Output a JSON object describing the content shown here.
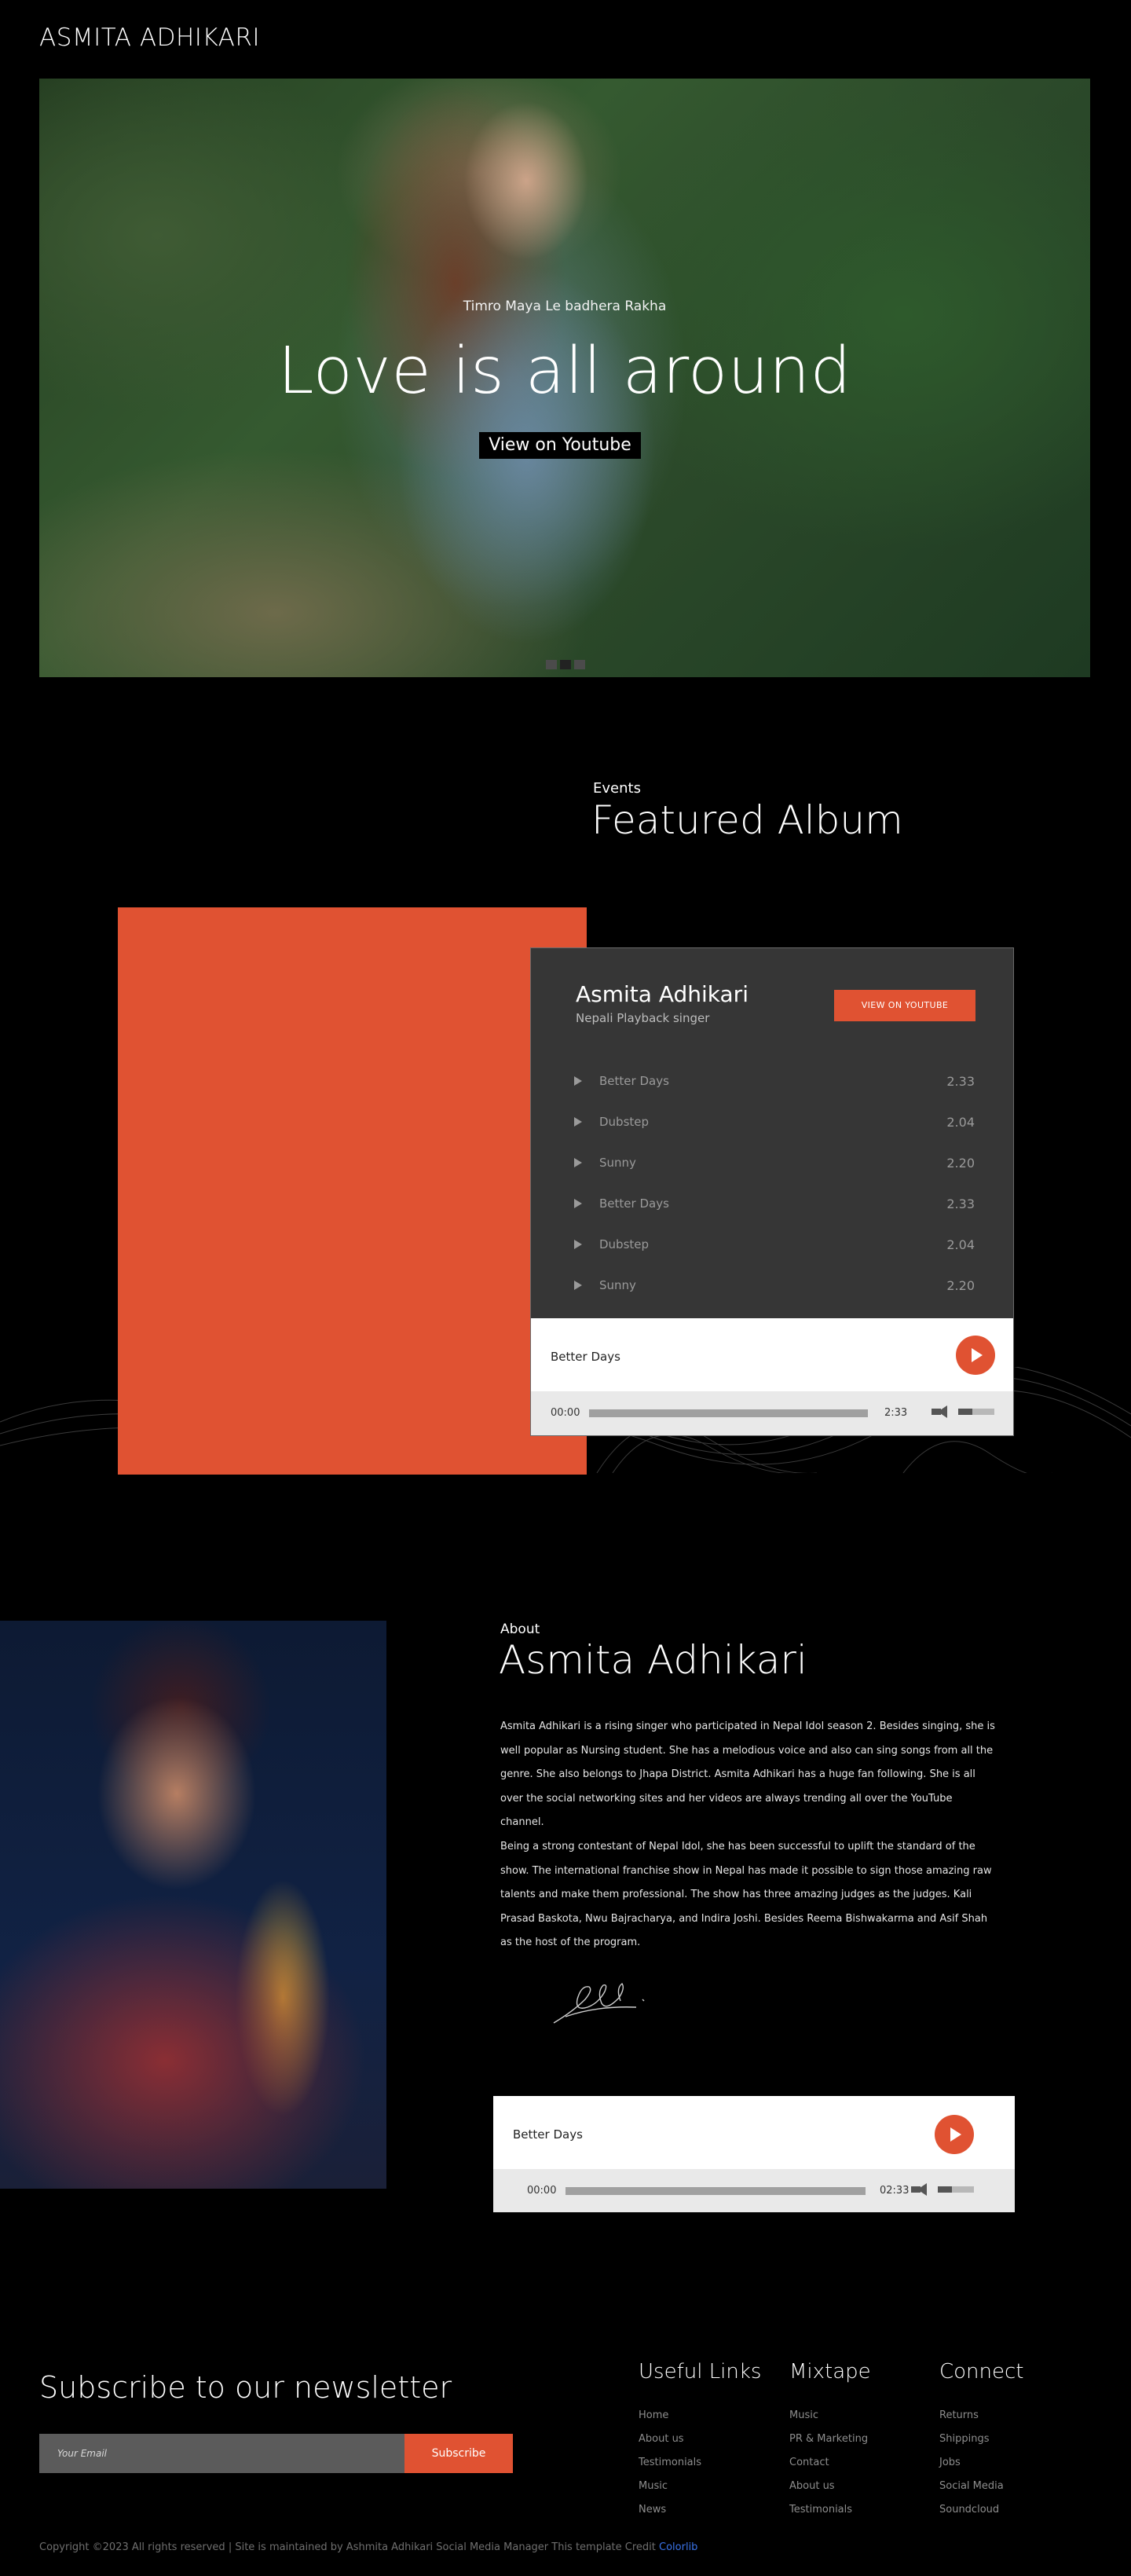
{
  "brand": "ASMITA ADHIKARI",
  "hero": {
    "subtitle": "Timro Maya Le badhera Rakha",
    "title": "Love is all around",
    "button": "View on Youtube",
    "slides": 3,
    "active_slide": 2
  },
  "featured": {
    "label": "Events",
    "title": "Featured Album"
  },
  "album_player": {
    "artist": "Asmita Adhikari",
    "role": "Nepali Playback singer",
    "button": "VIEW ON YOUTUBE",
    "tracks": [
      {
        "name": "Better Days",
        "duration": "2.33"
      },
      {
        "name": "Dubstep",
        "duration": "2.04"
      },
      {
        "name": "Sunny",
        "duration": "2.20"
      },
      {
        "name": "Better Days",
        "duration": "2.33"
      },
      {
        "name": "Dubstep",
        "duration": "2.04"
      },
      {
        "name": "Sunny",
        "duration": "2.20"
      }
    ],
    "now_playing": "Better Days",
    "time_current": "00:00",
    "time_total": "2:33",
    "progress": 0,
    "volume": 0.4
  },
  "about": {
    "label": "About",
    "title": "Asmita Adhikari",
    "paragraphs": [
      "Asmita Adhikari is a rising singer who participated in Nepal Idol season 2. Besides singing, she is well popular as Nursing student. She has a melodious voice and also can sing songs from all the genre. She also belongs to Jhapa District. Asmita Adhikari has a huge fan following. She is all over the social networking sites and her videos are always trending all over the YouTube channel.",
      "Being a strong contestant of Nepal Idol, she has been successful to uplift the standard of the show. The international franchise show in Nepal has made it possible to sign those amazing raw talents and make them professional. The show has three amazing judges as the judges. Kali Prasad Baskota, Nwu Bajracharya, and Indira Joshi. Besides Reema Bishwakarma and Asif Shah as the host of the program."
    ],
    "player": {
      "now_playing": "Better Days",
      "time_current": "00:00",
      "time_total": "02:33",
      "progress": 0,
      "volume": 0.4
    }
  },
  "newsletter": {
    "title": "Subscribe to our newsletter",
    "placeholder": "Your Email",
    "button": "Subscribe"
  },
  "footer": {
    "columns": [
      {
        "title": "Useful Links",
        "links": [
          "Home",
          "About us",
          "Testimonials",
          "Music",
          "News"
        ]
      },
      {
        "title": "Mixtape",
        "links": [
          "Music",
          "PR & Marketing",
          "Contact",
          "About us",
          "Testimonials"
        ]
      },
      {
        "title": "Connect",
        "links": [
          "Returns",
          "Shippings",
          "Jobs",
          "Social Media",
          "Soundcloud"
        ]
      }
    ],
    "copyright": "Copyright ©2023 All rights reserved | Site is maintained by Ashmita Adhikari Social Media Manager This template Credit",
    "credit": "Colorlib"
  },
  "colors": {
    "accent": "#e05232",
    "background": "#000000",
    "player_dark": "#363636",
    "link": "#3a73e8"
  }
}
